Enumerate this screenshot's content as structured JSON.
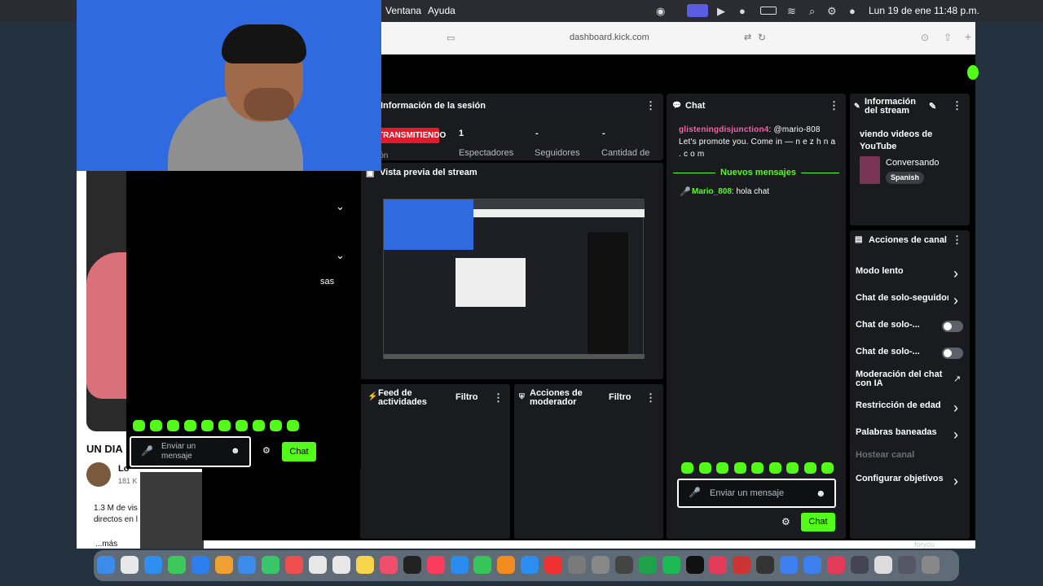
{
  "menubar": {
    "ventana": "Ventana",
    "ayuda": "Ayuda",
    "datetime": "Lun 19 de ene  11:48 p.m."
  },
  "browser": {
    "url": "dashboard.kick.com"
  },
  "session": {
    "title": "Información de la sesión",
    "badge": "TRANSMITIENDO",
    "sub": "sión",
    "stats": [
      {
        "value": "1",
        "label": "Espectadores"
      },
      {
        "value": "-",
        "label": "Seguidores"
      },
      {
        "value": "-",
        "label": "Cantidad de"
      }
    ]
  },
  "preview": {
    "title": "Vista previa del stream"
  },
  "activity": {
    "title_line1": "Feed de",
    "title_line2": "actividades",
    "filter": "Filtro"
  },
  "modactions": {
    "title_line1": "Acciones de",
    "title_line2": "moderador",
    "filter": "Filtro"
  },
  "chat": {
    "title": "Chat",
    "messages": [
      {
        "user": "glisteningdisjunction4",
        "text": ": @mario-808 Let's promote you. Come in — n e z h n a . c o m"
      },
      {
        "user": "Mario_808",
        "text": ": hola chat"
      }
    ],
    "new_messages": "Nuevos mensajes",
    "input_placeholder": "Enviar un mensaje",
    "send": "Chat"
  },
  "stream_info": {
    "title_line1": "Información",
    "title_line2": "del stream",
    "stream_title": "viendo videos de YouTube",
    "category": "Conversando",
    "language": "Spanish"
  },
  "channel_actions": {
    "title": "Acciones de canal",
    "items": [
      {
        "label": "Modo lento",
        "control": "chevron"
      },
      {
        "label": "Chat de solo-seguidores",
        "control": "chevron"
      },
      {
        "label": "Chat de solo-...",
        "control": "toggle"
      },
      {
        "label": "Chat de solo-...",
        "control": "toggle"
      },
      {
        "label": "Moderación del chat con IA",
        "control": "external"
      },
      {
        "label": "Restricción de edad",
        "control": "chevron"
      },
      {
        "label": "Palabras baneadas",
        "control": "chevron"
      },
      {
        "label": "Hostear canal",
        "control": "none"
      },
      {
        "label": "Configurar objetivos",
        "control": "chevron"
      }
    ]
  },
  "popout_chat": {
    "input_placeholder": "Enviar un mensaje",
    "send": "Chat",
    "fragment": "sas"
  },
  "youtube": {
    "title_fragment": "UN DIA",
    "channel_fragment": "Lo",
    "subs_fragment": "181 K",
    "views_line1": "1.3 M de vis",
    "views_line2": "directos en l",
    "more": "...más",
    "foryou": "foryou"
  },
  "colors": {
    "kick_green": "#53fc18",
    "live_red": "#e6192b",
    "username_pink": "#ff5ea8",
    "username_green": "#53fc18"
  }
}
